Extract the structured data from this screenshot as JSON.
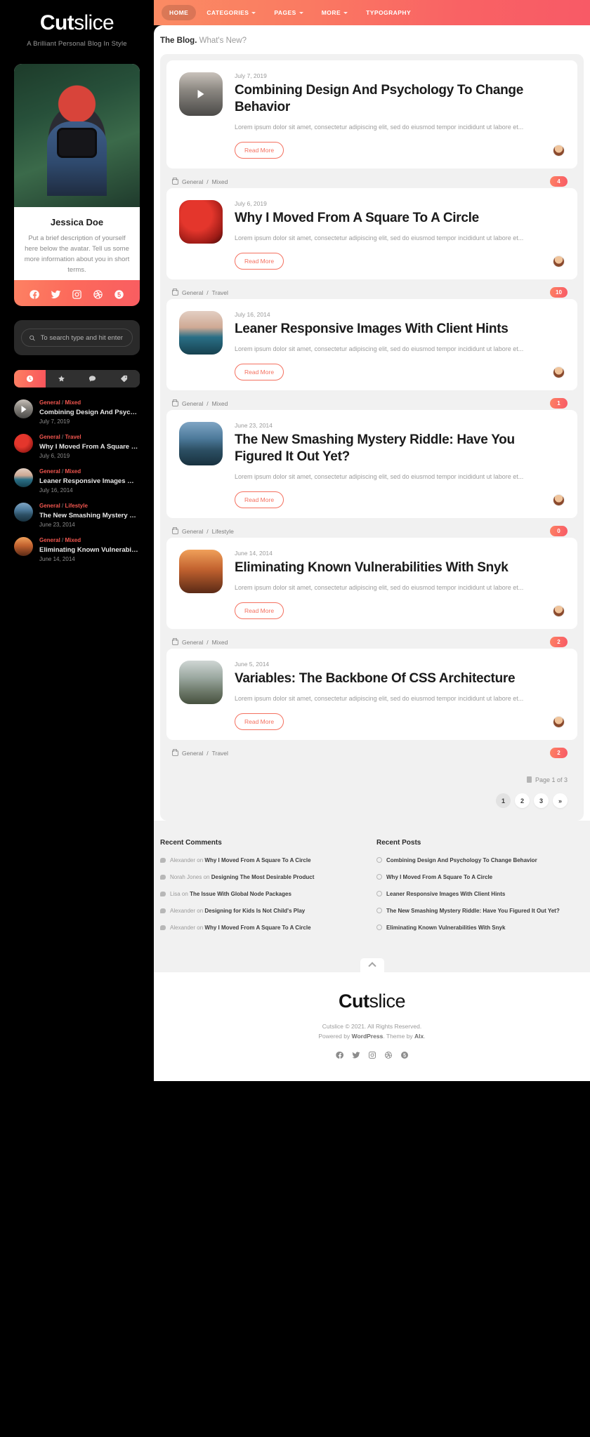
{
  "brand": {
    "bold": "Cut",
    "thin": "slice",
    "tagline": "A Brilliant Personal Blog In Style"
  },
  "nav": {
    "items": [
      {
        "label": "HOME",
        "caret": false,
        "active": true
      },
      {
        "label": "CATEGORIES",
        "caret": true,
        "active": false
      },
      {
        "label": "PAGES",
        "caret": true,
        "active": false
      },
      {
        "label": "MORE",
        "caret": true,
        "active": false
      },
      {
        "label": "TYPOGRAPHY",
        "caret": false,
        "active": false
      }
    ]
  },
  "profile": {
    "name": "Jessica Doe",
    "description": "Put a brief description of yourself here below the avatar. Tell us some more information about you in short terms.",
    "socials": [
      "facebook-icon",
      "twitter-icon",
      "instagram-icon",
      "dribbble-icon",
      "fivehundredpx-icon"
    ]
  },
  "search": {
    "placeholder": "To search type and hit enter",
    "value": ""
  },
  "sidebar_tabs": [
    {
      "icon": "clock-icon",
      "active": true
    },
    {
      "icon": "star-icon",
      "active": false
    },
    {
      "icon": "comment-icon",
      "active": false
    },
    {
      "icon": "tag-icon",
      "active": false
    }
  ],
  "sidebar_posts": [
    {
      "cat": "General",
      "sub": "Mixed",
      "title": "Combining Design And Psychology T...",
      "date": "July 7, 2019",
      "thumb": "ph-road",
      "video": true
    },
    {
      "cat": "General",
      "sub": "Travel",
      "title": "Why I Moved From A Square To A Cir...",
      "date": "July 6, 2019",
      "thumb": "ph-berry",
      "video": false
    },
    {
      "cat": "General",
      "sub": "Mixed",
      "title": "Leaner Responsive Images With Clie...",
      "date": "July 16, 2014",
      "thumb": "ph-eyes",
      "video": false
    },
    {
      "cat": "General",
      "sub": "Lifestyle",
      "title": "The New Smashing Mystery Riddle: ...",
      "date": "June 23, 2014",
      "thumb": "ph-lake",
      "video": false
    },
    {
      "cat": "General",
      "sub": "Mixed",
      "title": "Eliminating Known Vulnerabilities Wit...",
      "date": "June 14, 2014",
      "thumb": "ph-tent",
      "video": false
    }
  ],
  "blog_header": {
    "title": "The Blog.",
    "subtitle": "What's New?"
  },
  "read_more_label": "Read More",
  "excerpt": "Lorem ipsum dolor sit amet, consectetur adipiscing elit, sed do eiusmod tempor incididunt ut labore et...",
  "posts": [
    {
      "date": "July 7, 2019",
      "title": "Combining Design And Psychology To Change Behavior",
      "cat": "General",
      "sub": "Mixed",
      "count": "4",
      "thumb": "ph-road",
      "video": true
    },
    {
      "date": "July 6, 2019",
      "title": "Why I Moved From A Square To A Circle",
      "cat": "General",
      "sub": "Travel",
      "count": "10",
      "thumb": "ph-berry",
      "video": false
    },
    {
      "date": "July 16, 2014",
      "title": "Leaner Responsive Images With Client Hints",
      "cat": "General",
      "sub": "Mixed",
      "count": "1",
      "thumb": "ph-eyes",
      "video": false
    },
    {
      "date": "June 23, 2014",
      "title": "The New Smashing Mystery Riddle: Have You Figured It Out Yet?",
      "cat": "General",
      "sub": "Lifestyle",
      "count": "0",
      "thumb": "ph-lake",
      "video": false
    },
    {
      "date": "June 14, 2014",
      "title": "Eliminating Known Vulnerabilities With Snyk",
      "cat": "General",
      "sub": "Mixed",
      "count": "2",
      "thumb": "ph-tent",
      "video": false
    },
    {
      "date": "June 5, 2014",
      "title": "Variables: The Backbone Of CSS Architecture",
      "cat": "General",
      "sub": "Travel",
      "count": "2",
      "thumb": "ph-cliff",
      "video": false
    }
  ],
  "pagination": {
    "label": "Page 1 of 3",
    "pages": [
      "1",
      "2",
      "3",
      "»"
    ],
    "current": "1"
  },
  "footer_widgets": {
    "comments": {
      "title": "Recent Comments",
      "items": [
        {
          "author": "Alexander",
          "on": "on",
          "post": "Why I Moved From A Square To A Circle"
        },
        {
          "author": "Norah Jones",
          "on": "on",
          "post": "Designing The Most Desirable Product"
        },
        {
          "author": "Lisa",
          "on": "on",
          "post": "The Issue With Global Node Packages"
        },
        {
          "author": "Alexander",
          "on": "on",
          "post": "Designing for Kids Is Not Child's Play"
        },
        {
          "author": "Alexander",
          "on": "on",
          "post": "Why I Moved From A Square To A Circle"
        }
      ]
    },
    "posts": {
      "title": "Recent Posts",
      "items": [
        "Combining Design And Psychology To Change Behavior",
        "Why I Moved From A Square To A Circle",
        "Leaner Responsive Images With Client Hints",
        "The New Smashing Mystery Riddle: Have You Figured It Out Yet?",
        "Eliminating Known Vulnerabilities With Snyk"
      ]
    }
  },
  "footer": {
    "logo_bold": "Cut",
    "logo_thin": "slice",
    "copyright": "Cutslice © 2021. All Rights Reserved.",
    "powered_prefix": "Powered by ",
    "powered_link": "WordPress",
    "theme_mid": ". Theme by ",
    "theme_link": "Alx",
    "socials": [
      "facebook-icon",
      "twitter-icon",
      "instagram-icon",
      "dribbble-icon",
      "fivehundredpx-icon"
    ]
  },
  "colors": {
    "accent_start": "#fd8163",
    "accent_end": "#f85a66",
    "accent_text": "#f2564f"
  }
}
